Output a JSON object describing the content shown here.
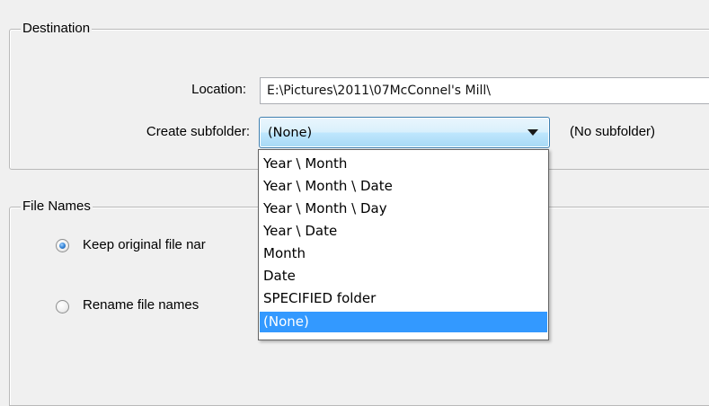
{
  "destination": {
    "legend": "Destination",
    "location_label": "Location:",
    "location_value": "E:\\Pictures\\2011\\07McConnel's Mill\\",
    "subfolder_label": "Create subfolder:",
    "subfolder_value": "(None)",
    "subfolder_hint": "(No subfolder)"
  },
  "dropdown": {
    "items": [
      "Year \\ Month",
      "Year \\ Month \\ Date",
      "Year \\ Month \\ Day",
      "Year \\ Date",
      "Month",
      "Date",
      "SPECIFIED folder",
      "(None)"
    ],
    "selected_index": 7
  },
  "file_names": {
    "legend": "File Names",
    "keep_label": "Keep original file nar",
    "rename_label": "Rename file names",
    "keep_checked": true
  },
  "colors": {
    "background": "#f0f0f0",
    "selection": "#3399ff",
    "combo_border": "#3c7fb1"
  }
}
